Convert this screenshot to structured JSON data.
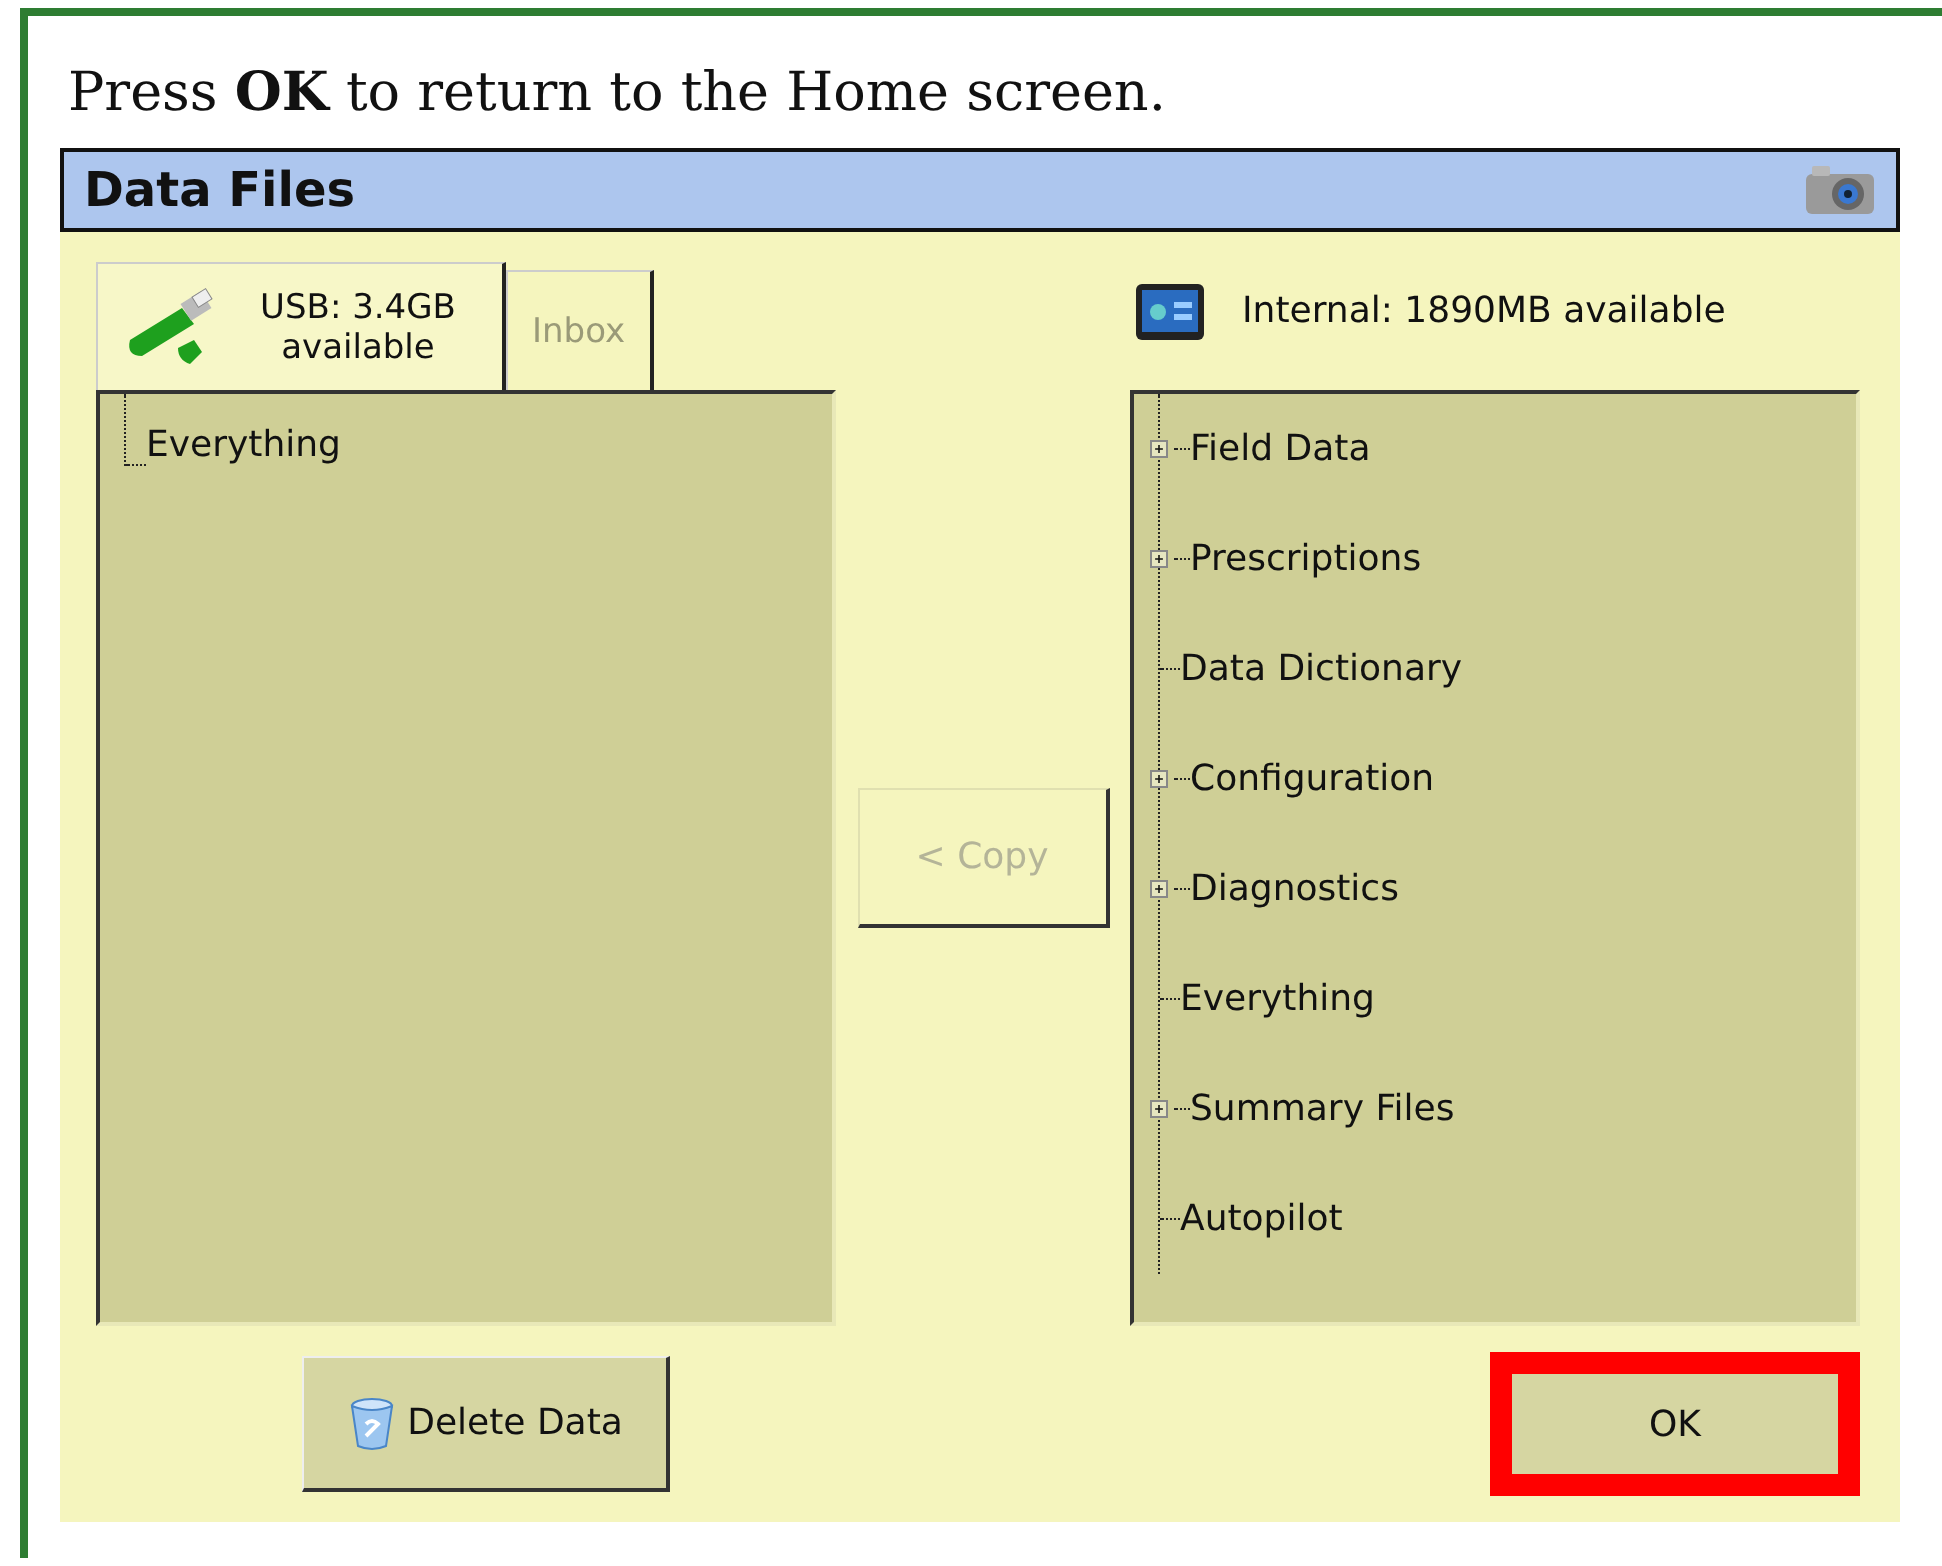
{
  "instruction": "Press **OK** to return to the Home screen.",
  "window": {
    "title": "Data Files"
  },
  "tabs": [
    {
      "label": "USB: 3.4GB available",
      "selected": true,
      "disabled": false
    },
    {
      "label": "Inbox",
      "selected": false,
      "disabled": true
    }
  ],
  "usb_tree": [
    {
      "label": "Everything",
      "kind": "leaf"
    }
  ],
  "copy_button": {
    "label": "< Copy",
    "disabled": true
  },
  "internal": {
    "label": "Internal: 1890MB available"
  },
  "internal_tree": [
    {
      "label": "Field Data",
      "kind": "folder"
    },
    {
      "label": "Prescriptions",
      "kind": "folder"
    },
    {
      "label": "Data Dictionary",
      "kind": "leaf"
    },
    {
      "label": "Configuration",
      "kind": "folder"
    },
    {
      "label": "Diagnostics",
      "kind": "folder"
    },
    {
      "label": "Everything",
      "kind": "leaf"
    },
    {
      "label": "Summary Files",
      "kind": "folder"
    },
    {
      "label": "Autopilot",
      "kind": "leaf"
    }
  ],
  "delete_button": {
    "label": "Delete Data"
  },
  "ok_button": {
    "label": "OK",
    "highlighted": true
  }
}
